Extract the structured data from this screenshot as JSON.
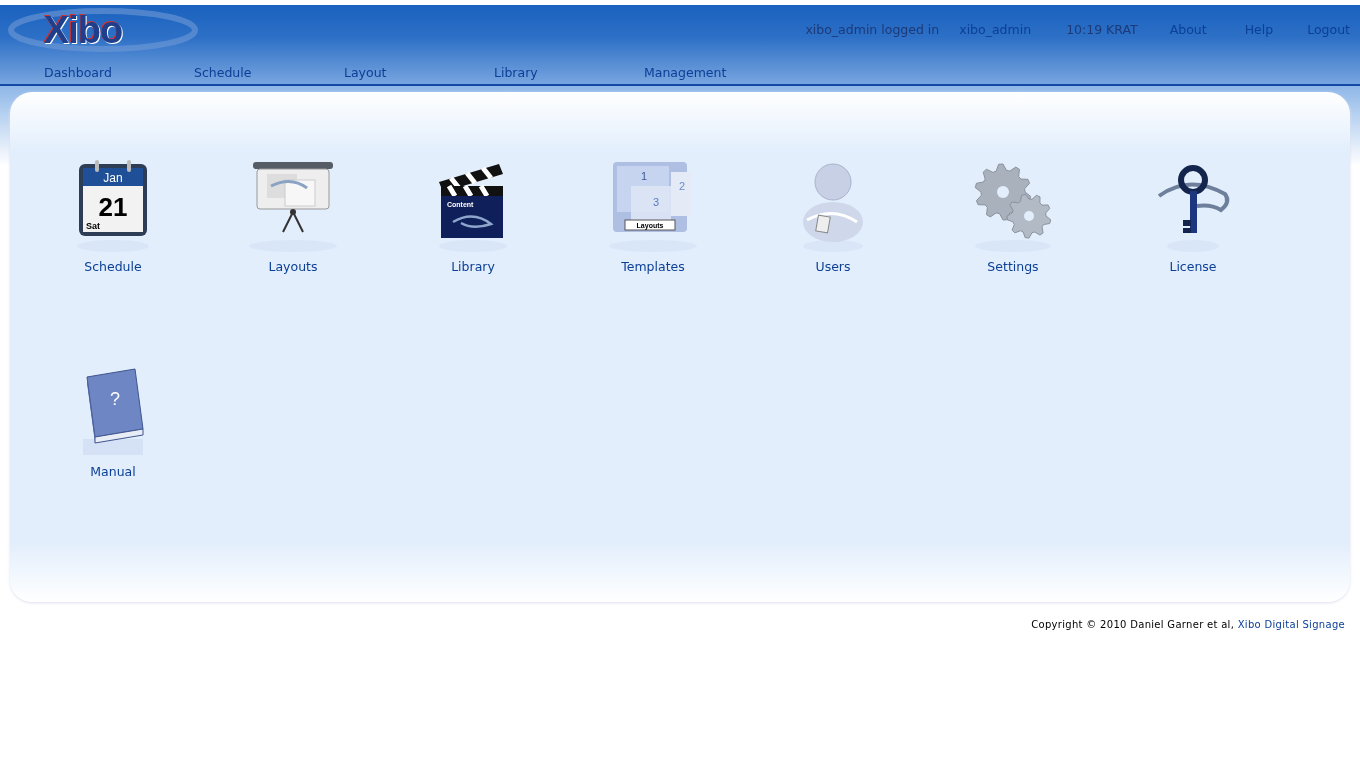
{
  "header": {
    "logo": "Xibo",
    "user_bar": [
      {
        "kind": "text",
        "label": "xibo_admin logged in"
      },
      {
        "kind": "link",
        "label": "xibo_admin"
      },
      {
        "kind": "text",
        "label": "10:19 KRAT"
      },
      {
        "kind": "link",
        "label": "About"
      },
      {
        "kind": "link",
        "label": "Help"
      },
      {
        "kind": "link",
        "label": "Logout"
      }
    ],
    "nav": [
      "Dashboard",
      "Schedule",
      "Layout",
      "Library",
      "Management"
    ]
  },
  "dashboard": [
    {
      "kind": "calendar",
      "label": "Schedule",
      "icon_texts": [
        "Jan",
        "21",
        "Sat"
      ]
    },
    {
      "kind": "projector",
      "label": "Layouts"
    },
    {
      "kind": "clapperboard",
      "label": "Library",
      "icon_texts": [
        "Content"
      ]
    },
    {
      "kind": "templates",
      "label": "Templates",
      "icon_texts": [
        "1",
        "2",
        "3",
        "Layouts"
      ]
    },
    {
      "kind": "user",
      "label": "Users"
    },
    {
      "kind": "gears",
      "label": "Settings"
    },
    {
      "kind": "key",
      "label": "License"
    },
    {
      "kind": "book",
      "label": "Manual",
      "icon_texts": [
        "?"
      ]
    }
  ],
  "footer": {
    "text": "Copyright © 2010 Daniel Garner et al,",
    "link": "Xibo Digital Signage"
  }
}
